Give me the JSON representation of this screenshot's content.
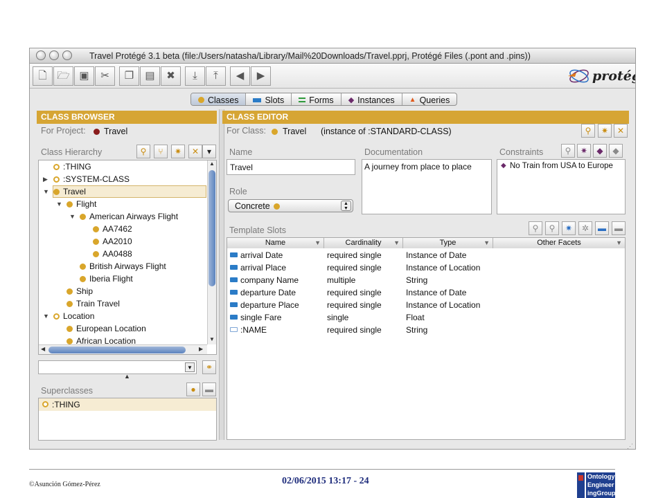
{
  "window": {
    "title": "Travel  Protégé 3.1 beta    (file:/Users/natasha/Library/Mail%20Downloads/Travel.pprj, Protégé Files (.pont and .pins))",
    "logo_text": "protégé"
  },
  "toolbar": {
    "buttons": [
      "new-file-icon",
      "open-folder-icon",
      "save-icon",
      "cut-icon",
      "copy-icon",
      "paste-icon",
      "delete-icon",
      "import-icon",
      "export-icon",
      "undo-icon",
      "redo-icon"
    ]
  },
  "tabs": [
    {
      "label": "Classes",
      "icon_color": "#d9a62b",
      "active": true
    },
    {
      "label": "Slots",
      "icon_color": "#2b7cc7",
      "active": false
    },
    {
      "label": "Forms",
      "icon_color": "#2e9a3a",
      "active": false
    },
    {
      "label": "Instances",
      "icon_color": "#6b2a6a",
      "active": false
    },
    {
      "label": "Queries",
      "icon_color": "#e05a1c",
      "active": false
    }
  ],
  "class_browser": {
    "header": "CLASS BROWSER",
    "for_project_label": "For Project:",
    "project_name": "Travel",
    "hierarchy_label": "Class Hierarchy",
    "tree": [
      {
        "label": ":THING",
        "depth": 0,
        "toggle": "",
        "system": true
      },
      {
        "label": ":SYSTEM-CLASS",
        "depth": 0,
        "toggle": "▶",
        "system": true
      },
      {
        "label": "Travel",
        "depth": 0,
        "toggle": "▼",
        "selected": true
      },
      {
        "label": "Flight",
        "depth": 1,
        "toggle": "▼"
      },
      {
        "label": "American Airways Flight",
        "depth": 2,
        "toggle": "▼"
      },
      {
        "label": "AA7462",
        "depth": 3,
        "toggle": ""
      },
      {
        "label": "AA2010",
        "depth": 3,
        "toggle": ""
      },
      {
        "label": "AA0488",
        "depth": 3,
        "toggle": ""
      },
      {
        "label": "British Airways Flight",
        "depth": 2,
        "toggle": ""
      },
      {
        "label": "Iberia Flight",
        "depth": 2,
        "toggle": ""
      },
      {
        "label": "Ship",
        "depth": 1,
        "toggle": ""
      },
      {
        "label": "Train Travel",
        "depth": 1,
        "toggle": ""
      },
      {
        "label": "Location",
        "depth": 0,
        "toggle": "▼",
        "system": true
      },
      {
        "label": "European Location",
        "depth": 1,
        "toggle": ""
      },
      {
        "label": "African Location",
        "depth": 1,
        "toggle": ""
      }
    ],
    "superclasses_label": "Superclasses",
    "superclasses": [
      ":THING"
    ]
  },
  "class_editor": {
    "header": "CLASS EDITOR",
    "for_class_label": "For Class:",
    "class_name": "Travel",
    "instance_of": "(instance of :STANDARD-CLASS)",
    "name_label": "Name",
    "name_value": "Travel",
    "documentation_label": "Documentation",
    "documentation_value": "A journey from place to place",
    "constraints_label": "Constraints",
    "constraints": [
      "No Train from USA to Europe"
    ],
    "role_label": "Role",
    "role_value": "Concrete",
    "template_slots_label": "Template Slots",
    "columns": [
      "Name",
      "Cardinality",
      "Type",
      "Other Facets"
    ],
    "slots": [
      {
        "name": "arrival Date",
        "cardinality": "required single",
        "type": "Instance of Date",
        "facets": "",
        "system": false
      },
      {
        "name": "arrival Place",
        "cardinality": "required single",
        "type": "Instance of Location",
        "facets": "",
        "system": false
      },
      {
        "name": "company Name",
        "cardinality": "multiple",
        "type": "String",
        "facets": "",
        "system": false
      },
      {
        "name": "departure Date",
        "cardinality": "required single",
        "type": "Instance of Date",
        "facets": "",
        "system": false
      },
      {
        "name": "departure Place",
        "cardinality": "required single",
        "type": "Instance of Location",
        "facets": "",
        "system": false
      },
      {
        "name": "single Fare",
        "cardinality": "single",
        "type": "Float",
        "facets": "",
        "system": false
      },
      {
        "name": ":NAME",
        "cardinality": "required single",
        "type": "String",
        "facets": "",
        "system": true
      }
    ]
  },
  "footer": {
    "author": "©Asunción Gómez-Pérez",
    "date_page": "02/06/2015 13:17 - 24",
    "logo_lines": [
      "Ontology",
      "Engineer",
      "ingGroup"
    ]
  }
}
